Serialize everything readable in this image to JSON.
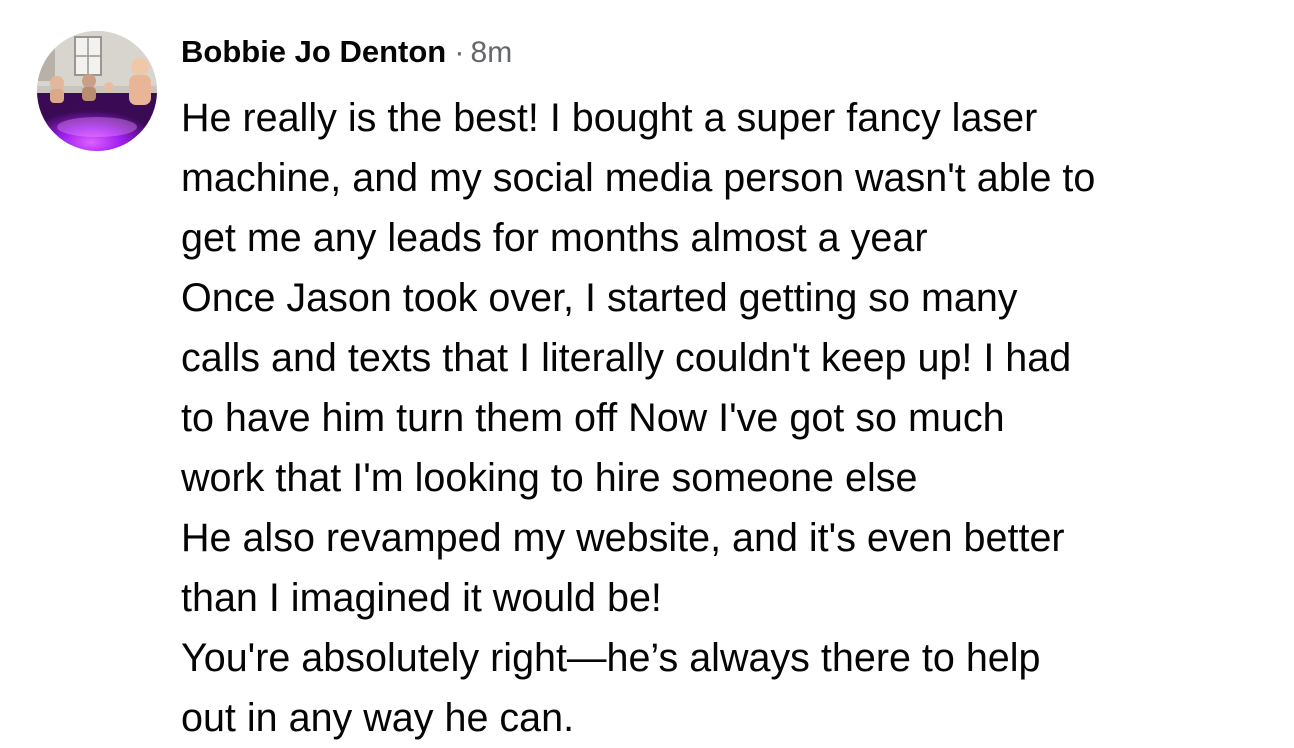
{
  "comment": {
    "author": "Bobbie Jo Denton",
    "separator": "·",
    "timestamp": "8m",
    "avatar_icon": "profile-photo-hot-tub",
    "lines": [
      "He really is the best! I bought a super fancy laser",
      "machine, and my social media person wasn't able to",
      "get me any leads for months almost a year",
      "Once Jason took over, I started getting so many",
      "calls and texts that I literally couldn't keep up! I had",
      "to have him turn them off Now I've got so much",
      "work that I'm looking to hire someone else",
      "He also revamped my website, and it's even better",
      "than I imagined it would be!",
      "You're absolutely right—he’s always there to help",
      "out in any way he can."
    ]
  },
  "colors": {
    "text": "#050505",
    "secondary_text": "#65676b",
    "avatar_accent": "#a020f0"
  }
}
